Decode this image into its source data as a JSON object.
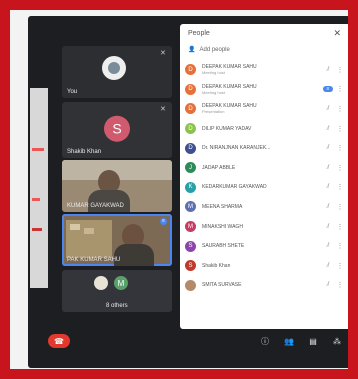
{
  "colors": {
    "frame": "#c8141c",
    "meet_bg": "#1d1e21",
    "hangup": "#e2382d"
  },
  "tiles": {
    "you": {
      "name": "You"
    },
    "shakib": {
      "initial": "S",
      "name": "Shakib Khan",
      "color": "#d05a6e"
    },
    "p1": {
      "name": "KUMAR GAYAKWAD"
    },
    "p2": {
      "name": "PAK KUMAR SAHU"
    },
    "others": {
      "initial": "M",
      "name": "8 others"
    }
  },
  "panel": {
    "title": "People",
    "close_icon": "close-icon",
    "add_label": "Add people",
    "people": [
      {
        "initial": "D",
        "color": "#e5713a",
        "name": "DEEPAK KUMAR SAHU",
        "sub": "Meeting host"
      },
      {
        "initial": "D",
        "color": "#e5713a",
        "name": "DEEPAK KUMAR SAHU",
        "sub": "Meeting host"
      },
      {
        "initial": "D",
        "color": "#e5713a",
        "name": "DEEPAK KUMAR SAHU",
        "sub": "Presentation"
      },
      {
        "initial": "D",
        "color": "#8bc34a",
        "name": "DILIP KUMAR YADAV",
        "sub": ""
      },
      {
        "initial": "D",
        "color": "#3f4f8f",
        "name": "Dr. NIRANJNAN KARANJEK...",
        "sub": ""
      },
      {
        "initial": "J",
        "color": "#2e8b57",
        "name": "JADAP ABBLE",
        "sub": ""
      },
      {
        "initial": "K",
        "color": "#27a0a8",
        "name": "KEDARKUMAR GAYAKWAD",
        "sub": ""
      },
      {
        "initial": "M",
        "color": "#5f6fae",
        "name": "MEENA SHARMA",
        "sub": ""
      },
      {
        "initial": "M",
        "color": "#c43b63",
        "name": "MINAKSHI WAGH",
        "sub": ""
      },
      {
        "initial": "S",
        "color": "#8e44ad",
        "name": "SAURABH SHETE",
        "sub": ""
      },
      {
        "initial": "S",
        "color": "#c0392b",
        "name": "Shakib Khan",
        "sub": ""
      },
      {
        "initial": "",
        "color": "#b48a6a",
        "name": "SMITA SURVASE",
        "sub": ""
      }
    ]
  },
  "toolbar": {
    "icons": [
      "info-icon",
      "people-icon",
      "chat-icon",
      "activities-icon"
    ]
  }
}
